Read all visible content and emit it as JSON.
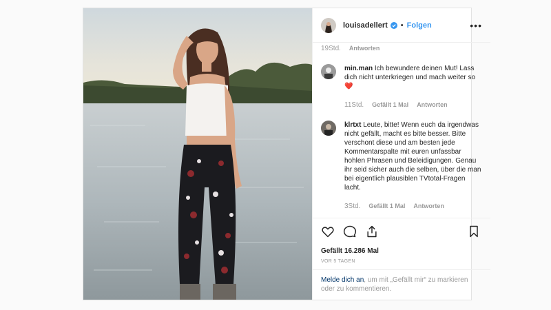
{
  "header": {
    "username": "louisadellert",
    "follow_label": "Folgen",
    "more_label": "•••"
  },
  "comments": {
    "top_meta": {
      "time": "19Std.",
      "reply": "Antworten"
    },
    "items": [
      {
        "user": "min.man",
        "text": "Ich bewundere deinen Mut! Lass dich nicht unterkriegen und mach weiter so",
        "emoji": "❤️",
        "time": "11Std.",
        "likes": "Gefällt 1 Mal",
        "reply": "Antworten"
      },
      {
        "user": "klrtxt",
        "text": "Leute, bitte! Wenn euch da irgendwas nicht gefällt, macht es bitte besser. Bitte verschont diese und am besten jede Kommentarspalte mit euren unfassbar hohlen Phrasen und Beleidigungen. Genau ihr seid sicher auch die selben, über die man bei eigentlich plausiblen TVtotal-Fragen lacht.",
        "time": "3Std.",
        "likes": "Gefällt 1 Mal",
        "reply": "Antworten"
      }
    ]
  },
  "actions": {
    "likes_text": "Gefällt 16.286 Mal",
    "ago": "VOR 5 TAGEN"
  },
  "login": {
    "link_text": "Melde dich an",
    "rest_text": ", um mit „Gefällt mir“ zu markieren oder zu kommentieren."
  },
  "icons": {
    "like": "heart-outline-icon",
    "comment": "comment-bubble-icon",
    "share": "share-icon",
    "save": "bookmark-icon",
    "verified": "verified-badge-icon"
  },
  "colors": {
    "accent": "#3897f0",
    "link": "#003569",
    "muted": "#999999"
  }
}
